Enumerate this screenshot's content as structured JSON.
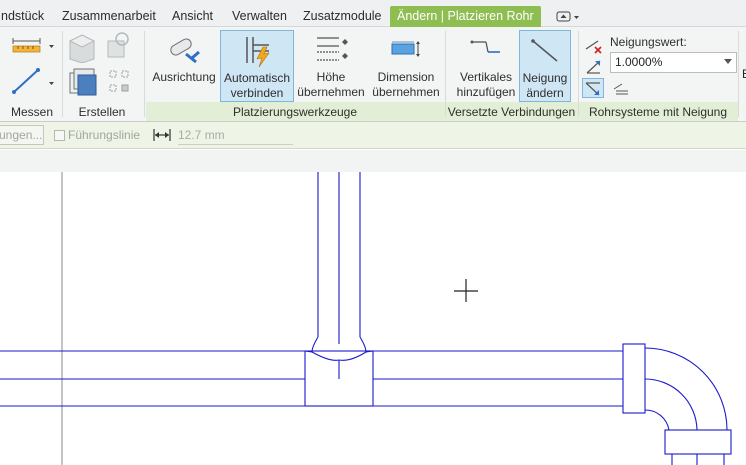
{
  "tabs": [
    {
      "label": "ndstück",
      "active": false
    },
    {
      "label": "Zusammenarbeit",
      "active": false
    },
    {
      "label": "Ansicht",
      "active": false
    },
    {
      "label": "Verwalten",
      "active": false
    },
    {
      "label": "Zusatzmodule",
      "active": false
    },
    {
      "label": "Ändern | Platzieren Rohr",
      "active": true
    }
  ],
  "ribbon": {
    "panels": {
      "messen": "Messen",
      "erstellen": "Erstellen",
      "platzierungswerkzeuge": "Platzierungswerkzeuge",
      "versetzte_verbindungen": "Versetzte Verbindungen",
      "rohrsysteme_mit_neigung": "Rohrsysteme mit Neigung"
    },
    "buttons": {
      "ausrichtung": "Ausrichtung",
      "automatisch_1": "Automatisch",
      "automatisch_2": "verbinden",
      "hoehe_1": "Höhe",
      "hoehe_2": "übernehmen",
      "dimension_1": "Dimension",
      "dimension_2": "übernehmen",
      "vertikales_1": "Vertikales",
      "vertikales_2": "hinzufügen",
      "neigung_1": "Neigung",
      "neigung_2": "ändern"
    },
    "slope": {
      "label": "Neigungswert:",
      "value": "1.0000%"
    }
  },
  "options_bar": {
    "button_label": "ungen...",
    "checkbox_label": "Führungslinie",
    "checkbox_checked": false,
    "offset_value": "12.7 mm"
  },
  "colors": {
    "accent_tab": "#8ebd52",
    "pipe_lines": "#1a1acc",
    "pressed": "#cfe6f5"
  }
}
